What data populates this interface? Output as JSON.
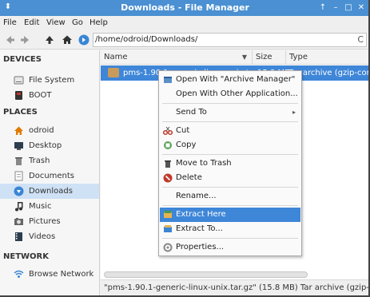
{
  "window": {
    "title": "Downloads - File Manager"
  },
  "titlebar": {
    "app_icon": "⬍",
    "controls": [
      "↑",
      "–",
      "□",
      "✕"
    ]
  },
  "menubar": {
    "items": [
      "File",
      "Edit",
      "View",
      "Go",
      "Help"
    ]
  },
  "toolbar": {
    "location": "/home/odroid/Downloads/",
    "reload_glyph": "C"
  },
  "sidebar": {
    "devices_header": "DEVICES",
    "places_header": "PLACES",
    "network_header": "NETWORK",
    "devices": [
      "File System",
      "BOOT"
    ],
    "places": [
      "odroid",
      "Desktop",
      "Trash",
      "Documents",
      "Downloads",
      "Music",
      "Pictures",
      "Videos"
    ],
    "network": [
      "Browse Network"
    ],
    "selected": "Downloads"
  },
  "columns": {
    "name": "Name",
    "size": "Size",
    "type": "Type"
  },
  "file": {
    "name": "pms-1.90.1-generic-linux-unix.tar.gz",
    "size": "15.8 MB",
    "type": "Tar archive (gzip-compressed)"
  },
  "status": {
    "text": "\"pms-1.90.1-generic-linux-unix.tar.gz\" (15.8 MB) Tar archive (gzip-compre..."
  },
  "context_menu": {
    "open_with_archive": "Open With \"Archive Manager\"",
    "open_with_other": "Open With Other Application...",
    "send_to": "Send To",
    "cut": "Cut",
    "copy": "Copy",
    "move_to_trash": "Move to Trash",
    "delete": "Delete",
    "rename": "Rename...",
    "extract_here": "Extract Here",
    "extract_to": "Extract To...",
    "properties": "Properties...",
    "active_item": "Extract Here"
  },
  "colors": {
    "accent": "#3e86d8",
    "titlebar": "#4a90d2",
    "sidebar_selected": "#cfe1f5"
  }
}
